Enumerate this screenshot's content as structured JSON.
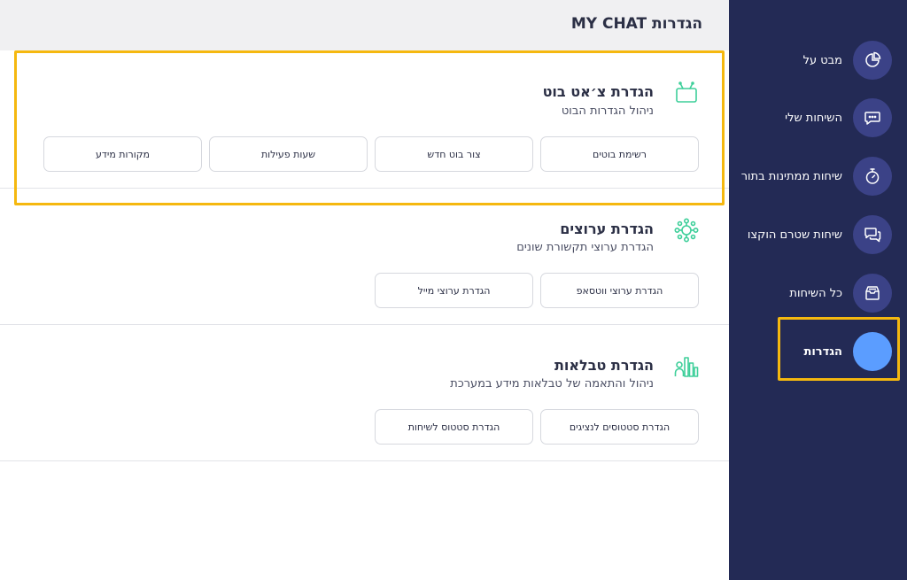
{
  "header": {
    "title": "הגדרות MY CHAT"
  },
  "sections": [
    {
      "title": "הגדרת צ׳אט בוט",
      "subtitle": "ניהול הגדרות הבוט",
      "icon": "tv-bot-icon",
      "buttons": [
        "רשימת בוטים",
        "צור בוט חדש",
        "שעות פעילות",
        "מקורות מידע"
      ]
    },
    {
      "title": "הגדרת ערוצים",
      "subtitle": "הגדרת ערוצי תקשורת שונים",
      "icon": "network-hub-icon",
      "buttons": [
        "הגדרת ערוצי ווטסאפ",
        "הגדרת ערוצי מייל"
      ]
    },
    {
      "title": "הגדרת טבלאות",
      "subtitle": "ניהול והתאמה של טבלאות מידע במערכת",
      "icon": "user-chart-icon",
      "buttons": [
        "הגדרת סטטוסים לנציגים",
        "הגדרת סטטוס לשיחות"
      ]
    }
  ],
  "sidebar": {
    "items": [
      {
        "label": "מבט על",
        "icon": "pie-chart-icon"
      },
      {
        "label": "השיחות שלי",
        "icon": "chat-bubble-icon"
      },
      {
        "label": "שיחות ממתינות בתור",
        "icon": "stopwatch-icon"
      },
      {
        "label": "שיחות שטרם הוקצו",
        "icon": "chats-icon"
      },
      {
        "label": "כל השיחות",
        "icon": "inbox-icon"
      },
      {
        "label": "הגדרות",
        "icon": "settings-icon",
        "active": true
      }
    ]
  },
  "colors": {
    "sidebar_bg": "#232a55",
    "nav_circle": "#3b4287",
    "active_circle": "#5b9dff",
    "accent_green": "#3ecf9a",
    "highlight": "#f5b80f"
  }
}
